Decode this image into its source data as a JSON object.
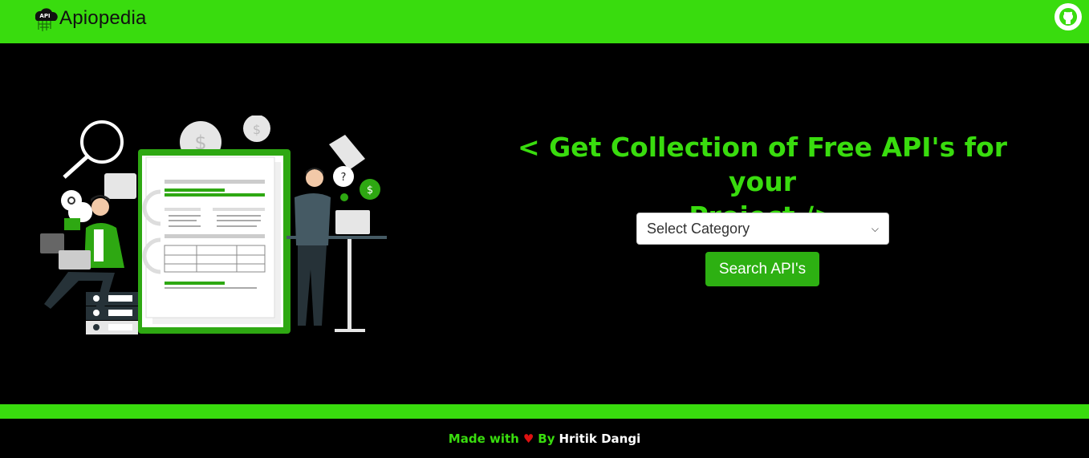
{
  "navbar": {
    "brand": "Apiopedia",
    "logo_text": "API",
    "logo_icon": "cloud-api-icon",
    "github_icon": "github-icon"
  },
  "hero": {
    "headline_line1": "< Get Collection of Free API's for your",
    "headline_line2": "Project />",
    "select_placeholder": "Select Category",
    "search_label": "Search API's",
    "illustration_icon": "developers-with-document-illustration"
  },
  "footer": {
    "made_with": "Made with",
    "heart": "♥",
    "by": "By",
    "author": "Hritik Dangi"
  },
  "colors": {
    "accent": "#39dc0e",
    "button": "#2db012",
    "background": "#000000"
  }
}
